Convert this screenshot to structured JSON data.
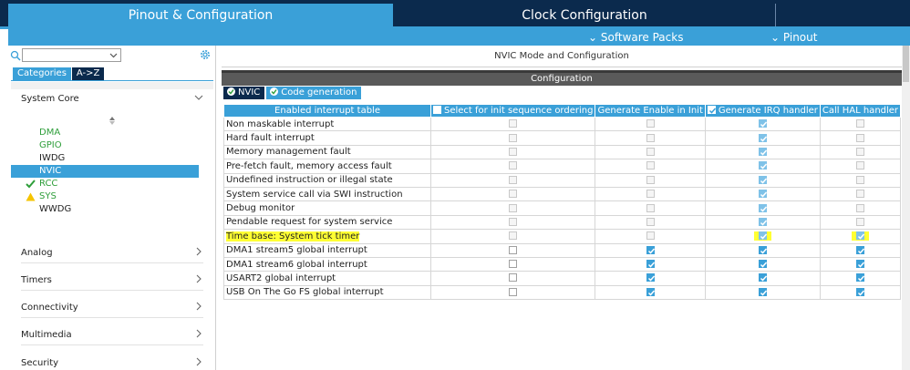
{
  "top_tabs": {
    "pinout": "Pinout & Configuration",
    "clock": "Clock Configuration"
  },
  "sub_menu": {
    "software_packs": "Software Packs",
    "pinout": "Pinout"
  },
  "left": {
    "search": {
      "value": "",
      "placeholder": ""
    },
    "tabs": {
      "categories": "Categories",
      "az": "A->Z"
    },
    "system_core": {
      "label": "System Core",
      "items": [
        {
          "label": "DMA",
          "status": "green"
        },
        {
          "label": "GPIO",
          "status": "green"
        },
        {
          "label": "IWDG",
          "status": "none"
        },
        {
          "label": "NVIC",
          "status": "selected"
        },
        {
          "label": "RCC",
          "status": "check"
        },
        {
          "label": "SYS",
          "status": "warning"
        },
        {
          "label": "WWDG",
          "status": "none"
        }
      ]
    },
    "sections": [
      "Analog",
      "Timers",
      "Connectivity",
      "Multimedia",
      "Security"
    ]
  },
  "right": {
    "title": "NVIC Mode and Configuration",
    "config_bar": "Configuration",
    "tabs": {
      "nvic": "NVIC",
      "code_generation": "Code generation"
    },
    "table": {
      "columns": [
        "Enabled interrupt table",
        "Select for init sequence ordering",
        "Generate Enable in Init",
        "Generate IRQ handler",
        "Call HAL handler"
      ],
      "rows": [
        {
          "name": "Non maskable interrupt",
          "init_seq": "dis",
          "enable_init": "dis",
          "irq": "on-dis",
          "hal": "dis",
          "highlight": false
        },
        {
          "name": "Hard fault interrupt",
          "init_seq": "dis",
          "enable_init": "dis",
          "irq": "on-dis",
          "hal": "dis",
          "highlight": false
        },
        {
          "name": "Memory management fault",
          "init_seq": "dis",
          "enable_init": "dis",
          "irq": "on-dis",
          "hal": "dis",
          "highlight": false
        },
        {
          "name": "Pre-fetch fault, memory access fault",
          "init_seq": "dis",
          "enable_init": "dis",
          "irq": "on-dis",
          "hal": "dis",
          "highlight": false
        },
        {
          "name": "Undefined instruction or illegal state",
          "init_seq": "dis",
          "enable_init": "dis",
          "irq": "on-dis",
          "hal": "dis",
          "highlight": false
        },
        {
          "name": "System service call via SWI instruction",
          "init_seq": "dis",
          "enable_init": "dis",
          "irq": "on-dis",
          "hal": "dis",
          "highlight": false
        },
        {
          "name": "Debug monitor",
          "init_seq": "dis",
          "enable_init": "dis",
          "irq": "on-dis",
          "hal": "dis",
          "highlight": false
        },
        {
          "name": "Pendable request for system service",
          "init_seq": "dis",
          "enable_init": "dis",
          "irq": "on-dis",
          "hal": "dis",
          "highlight": false
        },
        {
          "name": "Time base: System tick timer",
          "init_seq": "dis",
          "enable_init": "dis",
          "irq": "on-dis",
          "hal": "on-dis",
          "highlight": true
        },
        {
          "name": "DMA1 stream5 global interrupt",
          "init_seq": "off",
          "enable_init": "on",
          "irq": "on",
          "hal": "on",
          "highlight": false
        },
        {
          "name": "DMA1 stream6 global interrupt",
          "init_seq": "off",
          "enable_init": "on",
          "irq": "on",
          "hal": "on",
          "highlight": false
        },
        {
          "name": "USART2 global interrupt",
          "init_seq": "off",
          "enable_init": "on",
          "irq": "on",
          "hal": "on",
          "highlight": false
        },
        {
          "name": "USB On The Go FS global interrupt",
          "init_seq": "off",
          "enable_init": "on",
          "irq": "on",
          "hal": "on",
          "highlight": false
        }
      ]
    }
  },
  "colors": {
    "accent": "#3aa0d8",
    "navy": "#0b2a4d",
    "green": "#2e9e3a",
    "warning": "#f5c400",
    "highlight": "#ffff33"
  }
}
